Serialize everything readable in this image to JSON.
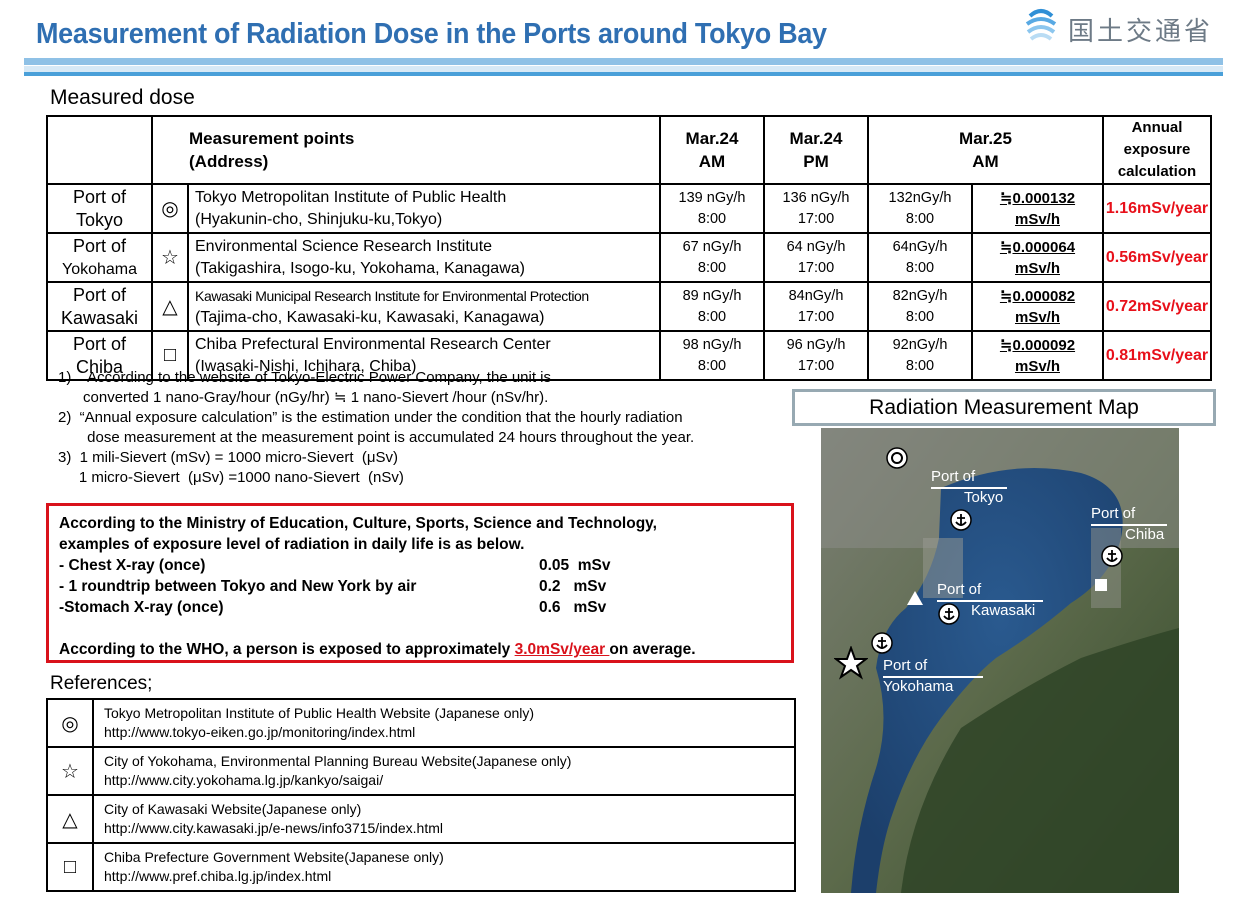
{
  "header": {
    "title": "Measurement of Radiation Dose in the Ports around Tokyo Bay",
    "logo_text": "国土交通省",
    "colors": {
      "title": "#2f6fb2",
      "accent_red": "#e8101a",
      "band_blue": "#4aa0d9"
    }
  },
  "dose_section": {
    "label": "Measured dose",
    "headers": {
      "points_line1": "Measurement points",
      "points_line2": "(Address)",
      "col1_line1": "Mar.24",
      "col1_line2": "AM",
      "col2_line1": "Mar.24",
      "col2_line2": "PM",
      "col3_line1": "Mar.25",
      "col3_line2": "AM",
      "annual_line1": "Annual exposure",
      "annual_line2": "calculation"
    },
    "rows": [
      {
        "port_line1": "Port of",
        "port_line2": "Tokyo",
        "symbol": "◎",
        "name": "Tokyo Metropolitan Institute of Public Health",
        "address": "(Hyakunin-cho, Shinjuku-ku,Tokyo)",
        "m1_value": "139 nGy/h",
        "m1_time": "8:00",
        "m2_value": "136 nGy/h",
        "m2_time": "17:00",
        "m3_value": "132nGy/h",
        "m3_time": "8:00",
        "msv_line1": "≒0.000132",
        "msv_line2": "mSv/h",
        "annual": "1.16mSv/year"
      },
      {
        "port_line1": "Port of",
        "port_line2": "Yokohama",
        "symbol": "☆",
        "name": "Environmental Science Research Institute",
        "address": "(Takigashira, Isogo-ku, Yokohama, Kanagawa)",
        "m1_value": "67 nGy/h",
        "m1_time": "8:00",
        "m2_value": "64 nGy/h",
        "m2_time": "17:00",
        "m3_value": "64nGy/h",
        "m3_time": "8:00",
        "msv_line1": "≒0.000064",
        "msv_line2": "mSv/h",
        "annual": "0.56mSv/year"
      },
      {
        "port_line1": "Port of",
        "port_line2": "Kawasaki",
        "symbol": "△",
        "name": "Kawasaki Municipal Research Institute for Environmental Protection",
        "address": "(Tajima-cho, Kawasaki-ku, Kawasaki, Kanagawa)",
        "m1_value": "89 nGy/h",
        "m1_time": "8:00",
        "m2_value": "84nGy/h",
        "m2_time": "17:00",
        "m3_value": "82nGy/h",
        "m3_time": "8:00",
        "msv_line1": "≒0.000082",
        "msv_line2": "mSv/h",
        "annual": "0.72mSv/year"
      },
      {
        "port_line1": "Port of",
        "port_line2": "Chiba",
        "symbol": "□",
        "name": "Chiba Prefectural Environmental Research Center",
        "address": "(Iwasaki-Nishi, Ichihara, Chiba)",
        "m1_value": "98 nGy/h",
        "m1_time": "8:00",
        "m2_value": "96 nGy/h",
        "m2_time": "17:00",
        "m3_value": "92nGy/h",
        "m3_time": "8:00",
        "msv_line1": "≒0.000092",
        "msv_line2": "mSv/h",
        "annual": "0.81mSv/year"
      }
    ]
  },
  "notes": [
    "1)    According to the website of Tokyo-Electric Power Company, the unit is",
    "      converted 1 nano-Gray/hour (nGy/hr) ≒ 1 nano-Sievert /hour (nSv/hr).",
    "2)  “Annual exposure calculation” is the estimation under the condition that the hourly radiation",
    "       dose measurement at the measurement point is accumulated 24 hours throughout the year.",
    "3)  1 mili-Sievert (mSv) = 1000 micro-Sievert  (μSv)",
    "     1 micro-Sievert  (μSv) =1000 nano-Sievert  (nSv)"
  ],
  "mext_box": {
    "intro_line1": "According to the Ministry of Education, Culture, Sports, Science and Technology,",
    "intro_line2": "examples of exposure level of radiation in daily life is as below.",
    "items": [
      {
        "label": "- Chest X-ray (once)",
        "amount": "0.05  mSv"
      },
      {
        "label": "- 1 roundtrip between Tokyo and New York by air",
        "amount": "0.2   mSv"
      },
      {
        "label": "-Stomach X-ray (once)",
        "amount": "0.6   mSv"
      }
    ],
    "who_prefix": "According to the WHO, a person is exposed to approximately ",
    "who_value": "3.0mSv/year ",
    "who_suffix": "on average."
  },
  "references": {
    "label": "References;",
    "items": [
      {
        "symbol": "◎",
        "title": "Tokyo Metropolitan Institute of Public Health Website (Japanese only)",
        "url": "http://www.tokyo-eiken.go.jp/monitoring/index.html"
      },
      {
        "symbol": "☆",
        "title": "City of Yokohama, Environmental Planning Bureau Website(Japanese only)",
        "url": "http://www.city.yokohama.lg.jp/kankyo/saigai/"
      },
      {
        "symbol": "△",
        "title": "City of Kawasaki Website(Japanese only)",
        "url": "http://www.city.kawasaki.jp/e-news/info3715/index.html"
      },
      {
        "symbol": "□",
        "title": "Chiba Prefecture Government Website(Japanese only)",
        "url": "http://www.pref.chiba.lg.jp/index.html"
      }
    ]
  },
  "map": {
    "title": "Radiation Measurement Map",
    "labels": {
      "tokyo_line1": "Port of",
      "tokyo_line2": "Tokyo",
      "chiba_line1": "Port of",
      "chiba_line2": "Chiba",
      "kawasaki_line1": "Port of",
      "kawasaki_line2": "Kawasaki",
      "yokohama_line1": "Port of",
      "yokohama_line2": "Yokohama"
    },
    "icons": [
      "double-circle-marker",
      "star-marker",
      "triangle-marker",
      "square-marker",
      "port-anchor-icon"
    ]
  }
}
